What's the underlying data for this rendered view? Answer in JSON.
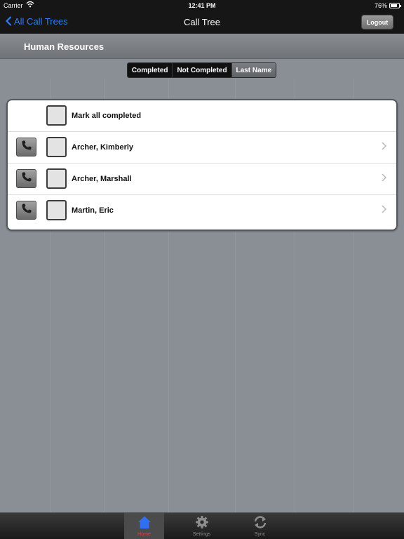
{
  "status_bar": {
    "carrier": "Carrier",
    "time": "12:41 PM",
    "battery": "76%",
    "battery_level": 0.76
  },
  "nav_bar": {
    "back_label": "All Call Trees",
    "title": "Call Tree",
    "logout_label": "Logout"
  },
  "section": {
    "title": "Human Resources"
  },
  "filter": {
    "segments": [
      "Completed",
      "Not Completed",
      "Last Name"
    ],
    "selected": "Last Name"
  },
  "list": {
    "mark_all_label": "Mark all completed",
    "contacts": [
      {
        "name": "Archer, Kimberly",
        "completed": false
      },
      {
        "name": "Archer, Marshall",
        "completed": false
      },
      {
        "name": "Martin, Eric",
        "completed": false
      }
    ]
  },
  "tab_bar": {
    "tabs": [
      {
        "label": "Home",
        "icon": "home-icon",
        "active": true
      },
      {
        "label": "Settings",
        "icon": "gear-icon",
        "active": false
      },
      {
        "label": "Sync",
        "icon": "sync-icon",
        "active": false
      }
    ]
  },
  "colors": {
    "accent_blue": "#2f7cf6",
    "background": "#8a8f96",
    "active_tab_icon": "#2f6ff0"
  }
}
